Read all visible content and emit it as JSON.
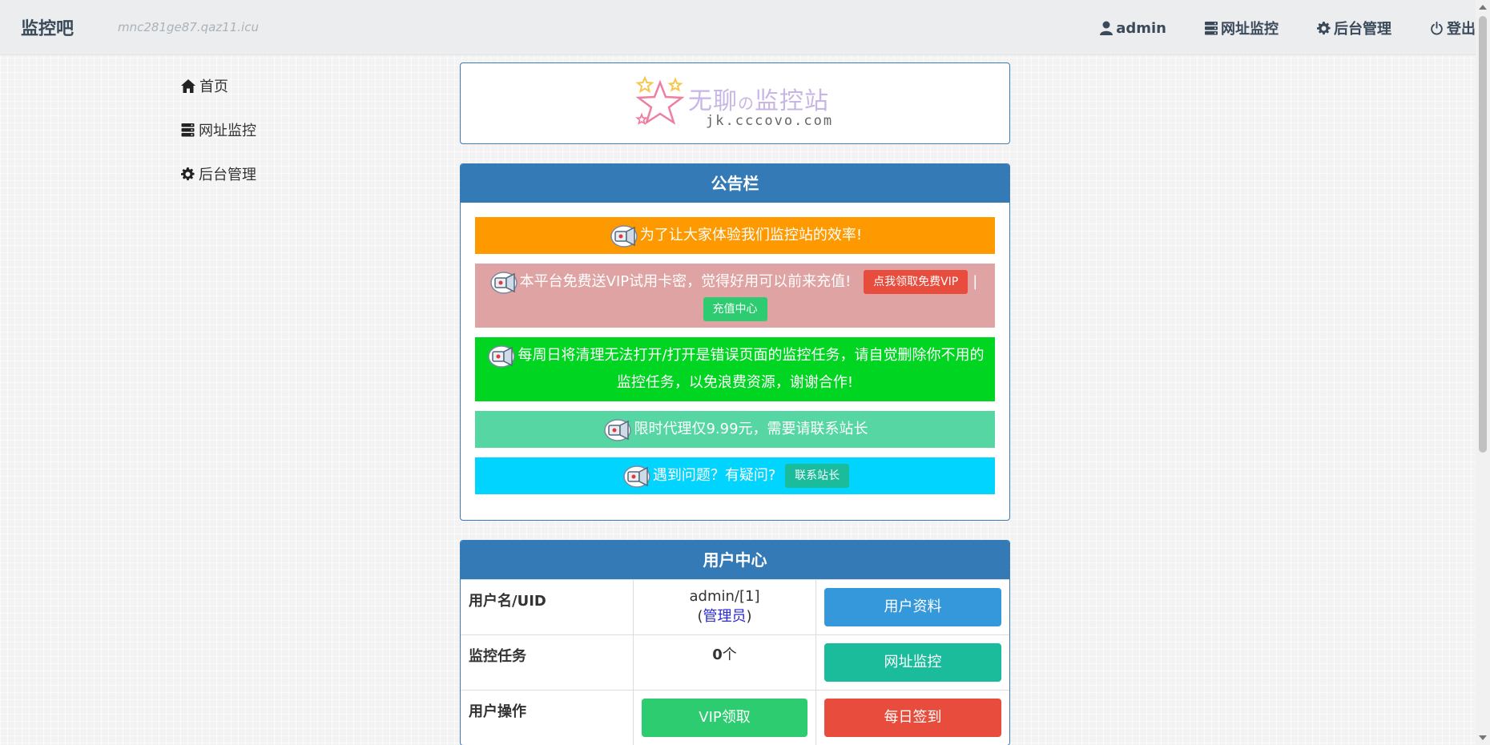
{
  "navbar": {
    "brand": "监控吧",
    "domain": "mnc281ge87.qaz11.icu",
    "items": [
      {
        "label": "admin",
        "icon": "user-icon"
      },
      {
        "label": "网址监控",
        "icon": "server-icon"
      },
      {
        "label": "后台管理",
        "icon": "gear-icon"
      },
      {
        "label": "登出",
        "icon": "power-icon"
      }
    ]
  },
  "sidebar": {
    "items": [
      {
        "label": "首页",
        "icon": "home-icon"
      },
      {
        "label": "网址监控",
        "icon": "server-icon"
      },
      {
        "label": "后台管理",
        "icon": "gear-icon"
      }
    ]
  },
  "logo": {
    "title_a": "无聊",
    "title_b": "の",
    "title_c": "监控站",
    "subtitle": "jk.cccovo.com"
  },
  "notice_board": {
    "title": "公告栏",
    "notices": [
      {
        "text": "为了让大家体验我们监控站的效率!",
        "color": "#ff9900"
      },
      {
        "text": "本平台免费送VIP试用卡密，觉得好用可以前来充值!",
        "color": "#e0a3a3",
        "btn1": "点我领取免费VIP",
        "btn1_color": "#e74c3c",
        "separator": "|",
        "btn2": "充值中心",
        "btn2_color": "#2ecc71"
      },
      {
        "text": "每周日将清理无法打开/打开是错误页面的监控任务，请自觉删除你不用的监控任务，以免浪费资源，谢谢合作!",
        "color": "#00d522"
      },
      {
        "text": "限时代理仅9.99元，需要请联系站长",
        "color": "#55d6a3"
      },
      {
        "text": "遇到问题？有疑问?",
        "color": "#00d4ff",
        "btn1": "联系站长",
        "btn1_color": "#1abc9c"
      }
    ]
  },
  "user_center": {
    "title": "用户中心",
    "rows": {
      "username_label": "用户名/UID",
      "username_value": "admin/[1]",
      "role_open": "(",
      "role": "管理员",
      "role_close": ")",
      "profile_btn": "用户资料",
      "tasks_label": "监控任务",
      "tasks_count": "0",
      "tasks_unit": "个",
      "monitor_btn": "网址监控",
      "ops_label": "用户操作",
      "vip_btn": "VIP领取",
      "signin_btn": "每日签到"
    }
  },
  "colors": {
    "primary": "#337ab7",
    "blue_btn": "#3498db",
    "teal_btn": "#1abc9c",
    "green_btn": "#2ecc71",
    "red_btn": "#e74c3c"
  }
}
